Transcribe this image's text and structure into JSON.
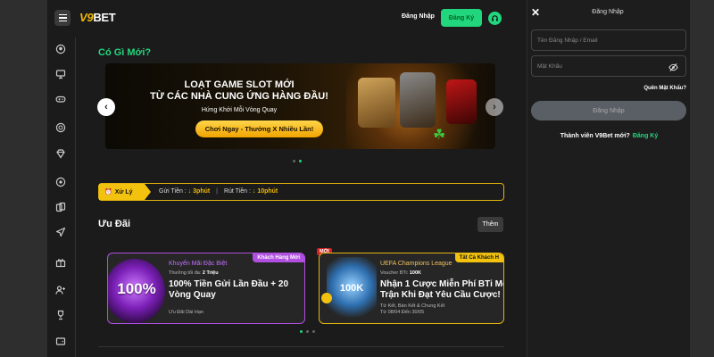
{
  "header": {
    "logo_prefix": "V9",
    "logo_suffix": "BET",
    "login_label": "Đăng Nhập",
    "register_label": "Đăng Ký"
  },
  "main": {
    "whats_new_title": "Có Gì Mới?",
    "banner": {
      "headline_1": "LOẠT GAME SLOT MỚI",
      "headline_2": "TỪ CÁC NHÀ CUNG ỨNG HÀNG ĐẦU!",
      "subline": "Hứng Khởi Mỗi Vòng Quay",
      "cta": "Chơi Ngay - Thưởng X Nhiều Lần!"
    },
    "ticker": {
      "tag": "Xử Lý",
      "deposit_label": "Gửi Tiền :",
      "deposit_value": "↓ 3phút",
      "withdraw_label": "Rút Tiền :",
      "withdraw_value": "↓ 10phút"
    },
    "promotions_title": "Ưu Đãi",
    "more_label": "Thêm",
    "promos": [
      {
        "tag": "Khách Hàng Mới",
        "kicker": "Khuyến Mãi Đặc Biệt",
        "minor_label": "Thưởng tối đa:",
        "minor_value": "2 Triệu",
        "headline": "100% Tiền Gửi Lần Đầu + 20 Vòng Quay",
        "footer_1": "Ưu Đãi Dài Hạn",
        "footer_2": "",
        "art_text": "100%"
      },
      {
        "tag": "Tất Cả Khách H",
        "kicker": "UEFA Champions League",
        "minor_label": "Voucher BTi:",
        "minor_value": "100K",
        "headline": "Nhận 1 Cược Miễn Phí BTi Mỗi Trận Khi Đạt Yêu Cầu Cược!",
        "footer_1": "Tứ Kết, Bán Kết & Chung Kết",
        "footer_2": "Từ 08/04 Đến 30/05",
        "art_text": "100K",
        "new_badge": "MỚI"
      }
    ]
  },
  "login_panel": {
    "title": "Đăng Nhập",
    "username_placeholder": "Tên Đăng Nhập / Email",
    "password_placeholder": "Mật Khẩu",
    "forgot_label": "Quên Mật Khẩu?",
    "submit_label": "Đăng Nhập",
    "member_text": "Thành viên V9Bet mới?",
    "member_link": "Đăng Ký"
  },
  "colors": {
    "accent_green": "#22d67d",
    "accent_gold": "#f3c20f",
    "promo_purple": "#b04fe0"
  },
  "sidebar_icons": [
    "sports-ball-icon",
    "monitor-icon",
    "gamepad-icon",
    "casino-chip-icon",
    "diamond-icon",
    "lottery-icon",
    "cards-icon",
    "rocket-icon",
    "gift-icon",
    "add-user-icon",
    "trophy-icon",
    "wallet-icon"
  ]
}
